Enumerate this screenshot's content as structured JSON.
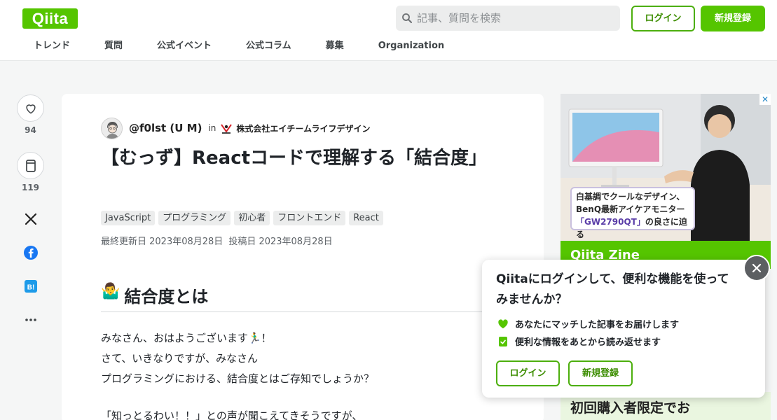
{
  "header": {
    "logo": "Qiita",
    "search_placeholder": "記事、質問を検索",
    "login_label": "ログイン",
    "signup_label": "新規登録",
    "nav": [
      "トレンド",
      "質問",
      "公式イベント",
      "公式コラム",
      "募集",
      "Organization"
    ]
  },
  "rail": {
    "likes": "94",
    "stocks": "119"
  },
  "article": {
    "author": "@f0lst (U M)",
    "in": "in",
    "org": "株式会社エイチームライフデザイン",
    "title": "【むっず】Reactコードで理解する「結合度」",
    "tags": [
      "JavaScript",
      "プログラミング",
      "初心者",
      "フロントエンド",
      "React"
    ],
    "updated": "最終更新日 2023年08月28日",
    "posted": "投稿日 2023年08月28日",
    "section_emoji": "🤷‍♂️",
    "section_title": "結合度とは",
    "paragraph1": [
      "みなさん、おはようございます🏃‍♂️！",
      "さて、いきなりですが、みなさん",
      "プログラミングにおける、結合度とはご存知でしょうか？"
    ],
    "paragraph2": "「知っとるわい！！」との声が聞こえてきそうですが、"
  },
  "ad": {
    "close": "✕",
    "caption_line1": "白基調でクールなデザイン、",
    "caption_line2": "BenQ最新アイケアモニター",
    "caption_model": "「GW2790QT」",
    "caption_suffix": "の良さに迫る",
    "banner": "Qiita Zine",
    "second_ad": "初回購入者限定でお"
  },
  "popup": {
    "title": "Qiitaにログインして、便利な機能を使ってみませんか？",
    "item1": "あなたにマッチした記事をお届けします",
    "item2": "便利な情報をあとから読み返せます",
    "login_label": "ログイン",
    "signup_label": "新規登録"
  },
  "colors": {
    "brand": "#55c500",
    "brand_dark": "#3c8d00"
  }
}
